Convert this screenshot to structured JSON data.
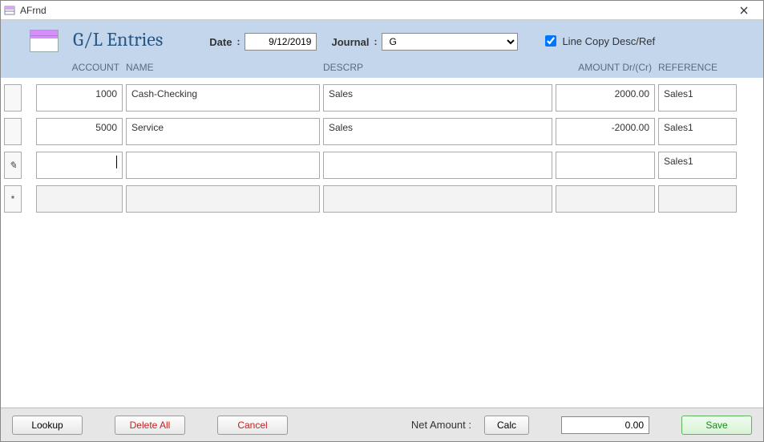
{
  "window": {
    "title": "AFrnd"
  },
  "header": {
    "form_title": "G/L Entries",
    "date_label": "Date",
    "date_value": "9/12/2019",
    "journal_label": "Journal",
    "journal_value": "G",
    "linecopy_label": "Line Copy Desc/Ref",
    "linecopy_checked": true
  },
  "columns": {
    "account": "ACCOUNT",
    "name": "NAME",
    "descrp": "DESCRP",
    "amount": "AMOUNT Dr/(Cr)",
    "reference": "REFERENCE"
  },
  "rows": [
    {
      "selector": "",
      "account": "1000",
      "name": "Cash-Checking",
      "descrp": "Sales",
      "amount": "2000.00",
      "reference": "Sales1",
      "editing": false,
      "new": false
    },
    {
      "selector": "",
      "account": "5000",
      "name": "Service",
      "descrp": "Sales",
      "amount": "-2000.00",
      "reference": "Sales1",
      "editing": false,
      "new": false
    },
    {
      "selector": "✎",
      "account": "",
      "name": "",
      "descrp": "",
      "amount": "",
      "reference": "Sales1",
      "editing": true,
      "new": false
    },
    {
      "selector": "*",
      "account": "",
      "name": "",
      "descrp": "",
      "amount": "",
      "reference": "",
      "editing": false,
      "new": true
    }
  ],
  "footer": {
    "lookup": "Lookup",
    "delete_all": "Delete All",
    "cancel": "Cancel",
    "net_amount_label": "Net Amount :",
    "calc": "Calc",
    "net_amount_value": "0.00",
    "save": "Save"
  }
}
